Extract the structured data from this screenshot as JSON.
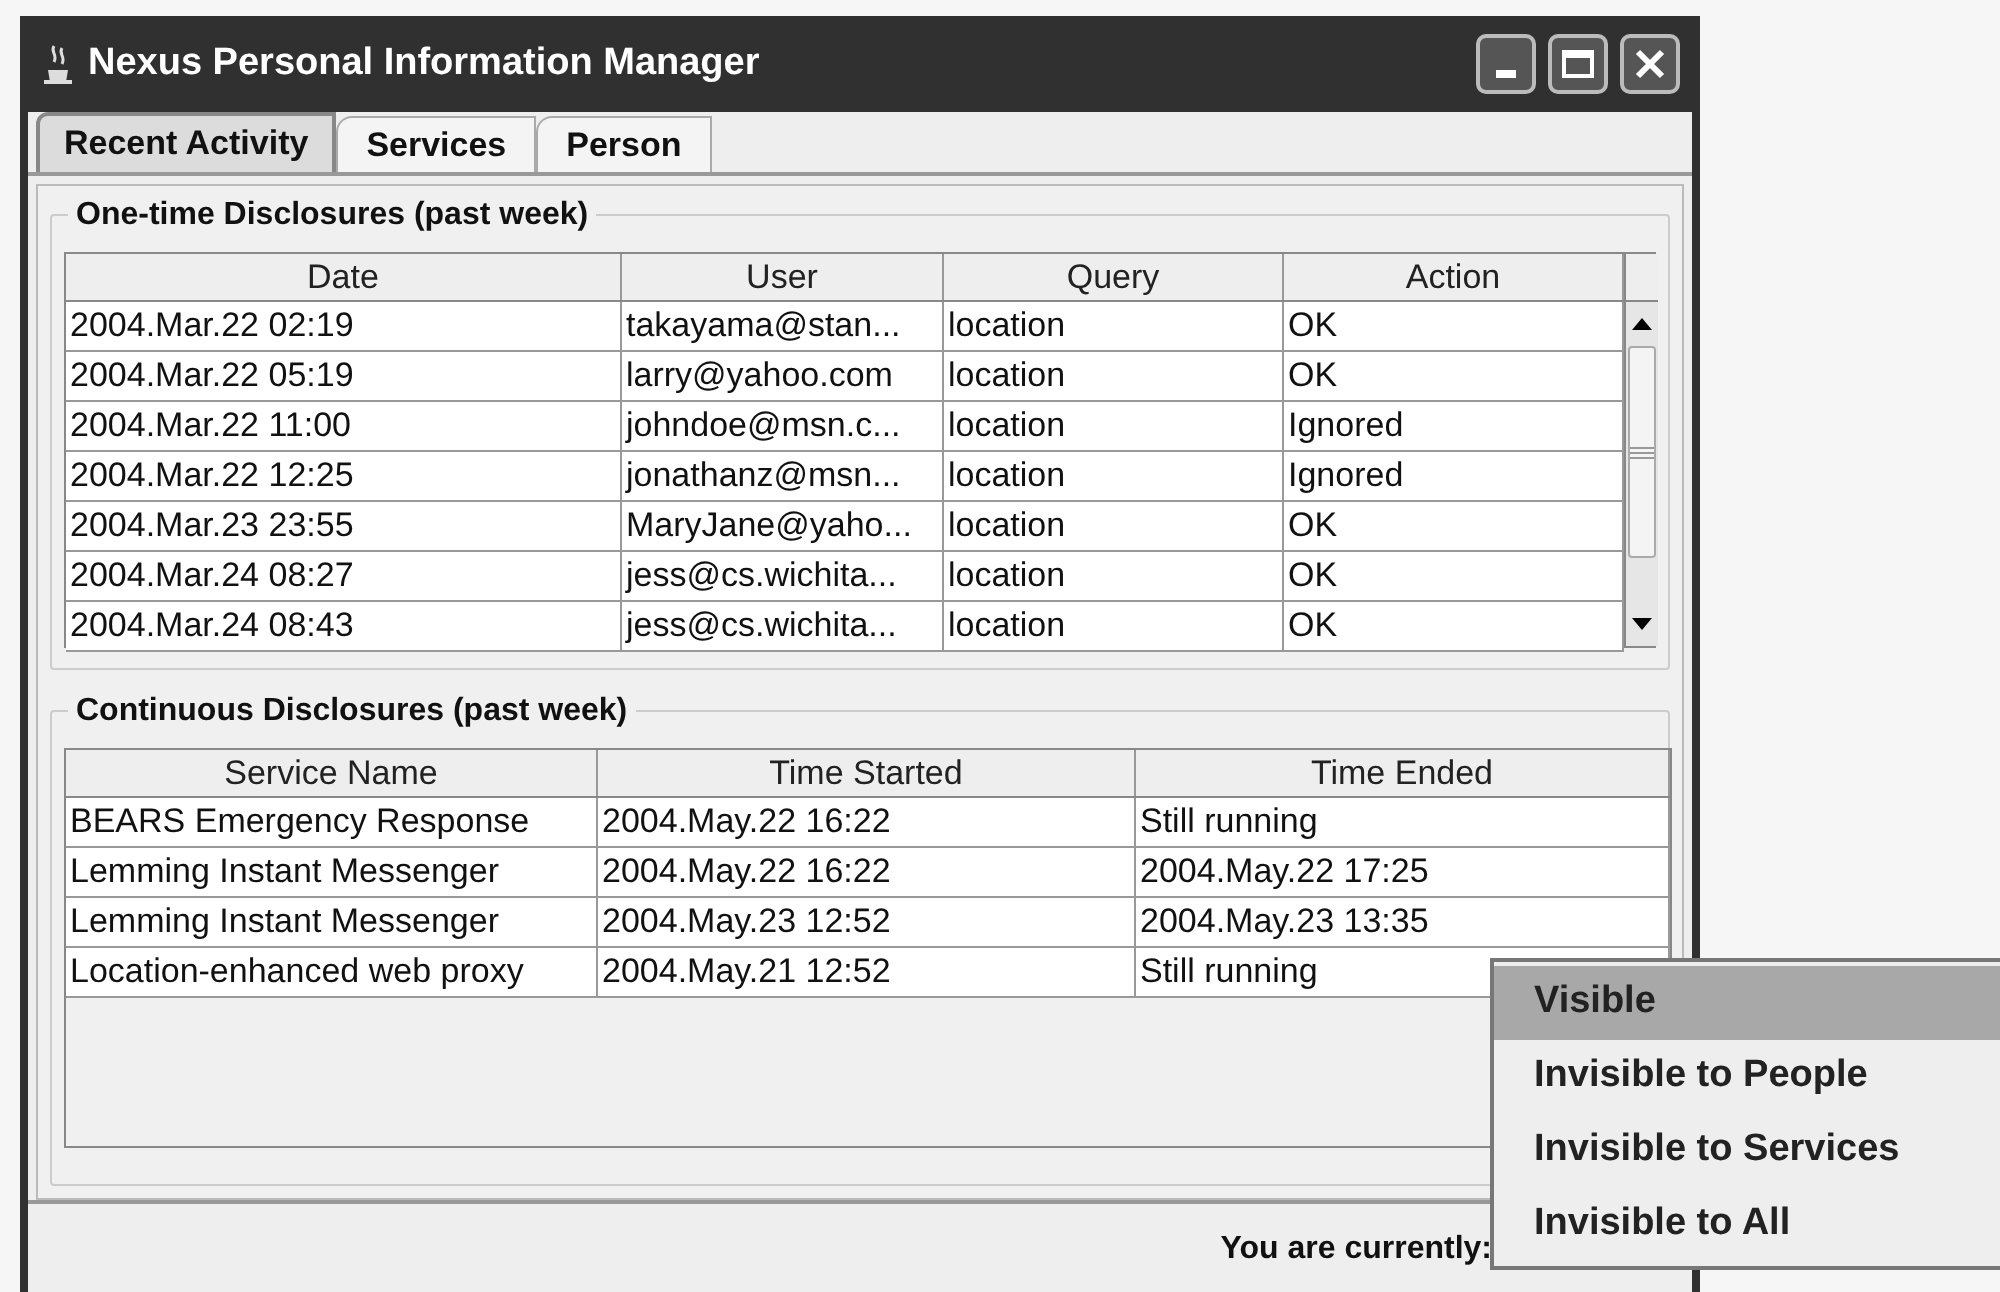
{
  "window": {
    "title": "Nexus Personal Information Manager"
  },
  "tabs": [
    {
      "label": "Recent Activity",
      "selected": true
    },
    {
      "label": "Services",
      "selected": false
    },
    {
      "label": "Person",
      "selected": false
    }
  ],
  "one_time": {
    "title": "One-time Disclosures (past week)",
    "columns": [
      "Date",
      "User",
      "Query",
      "Action"
    ],
    "rows": [
      [
        "2004.Mar.22 02:19",
        "takayama@stan...",
        "location",
        "OK"
      ],
      [
        "2004.Mar.22 05:19",
        "larry@yahoo.com",
        "location",
        "OK"
      ],
      [
        "2004.Mar.22 11:00",
        "johndoe@msn.c...",
        "location",
        "Ignored"
      ],
      [
        "2004.Mar.22 12:25",
        "jonathanz@msn...",
        "location",
        "Ignored"
      ],
      [
        "2004.Mar.23 23:55",
        "MaryJane@yaho...",
        "location",
        "OK"
      ],
      [
        "2004.Mar.24 08:27",
        "jess@cs.wichita...",
        "location",
        "OK"
      ],
      [
        "2004.Mar.24 08:43",
        "jess@cs.wichita...",
        "location",
        "OK"
      ]
    ]
  },
  "continuous": {
    "title": "Continuous Disclosures (past week)",
    "columns": [
      "Service Name",
      "Time Started",
      "Time Ended"
    ],
    "rows": [
      [
        "BEARS Emergency Response",
        "2004.May.22 16:22",
        "Still running"
      ],
      [
        "Lemming Instant Messenger",
        "2004.May.22 16:22",
        "2004.May.22 17:25"
      ],
      [
        "Lemming Instant Messenger",
        "2004.May.23 12:52",
        "2004.May.23 13:35"
      ],
      [
        "Location-enhanced web proxy",
        "2004.May.21 12:52",
        "Still running"
      ]
    ]
  },
  "status_bar": {
    "label": "You are currently:"
  },
  "popup_menu": {
    "items": [
      {
        "label": "Visible",
        "selected": true
      },
      {
        "label": "Invisible to People",
        "selected": false
      },
      {
        "label": "Invisible to Services",
        "selected": false
      },
      {
        "label": "Invisible to All",
        "selected": false
      }
    ]
  }
}
